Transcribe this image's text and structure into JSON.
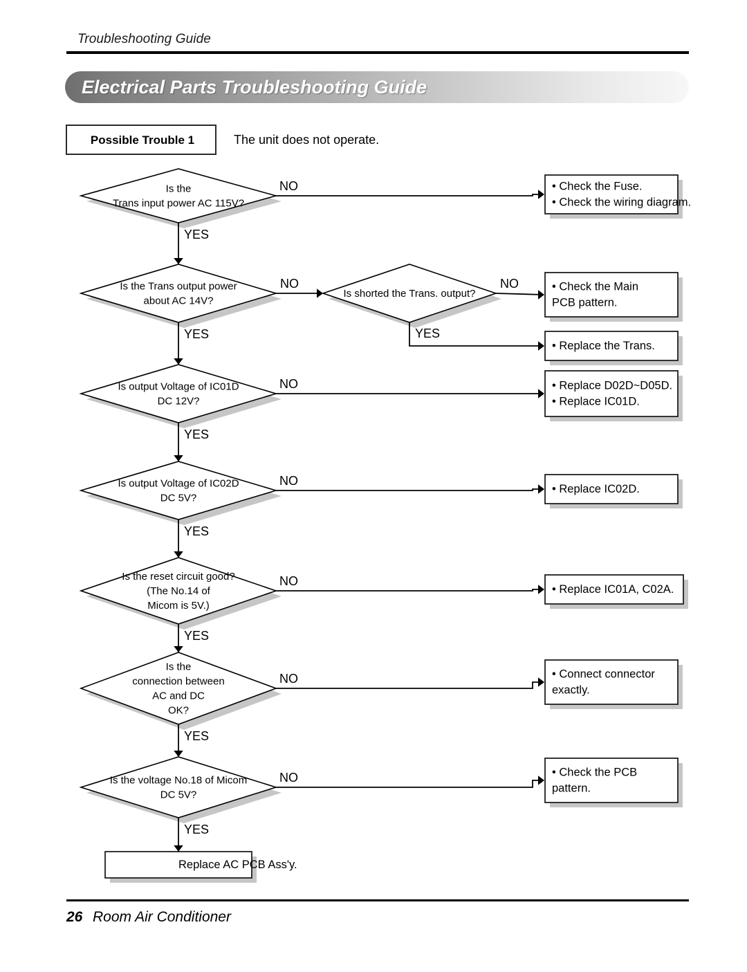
{
  "header": {
    "running_head": "Troubleshooting Guide",
    "banner_title": "Electrical Parts Troubleshooting Guide"
  },
  "trouble": {
    "label": "Possible Trouble 1",
    "description": "The unit does not operate."
  },
  "branch_labels": {
    "yes": "YES",
    "no": "NO"
  },
  "chart_data": {
    "type": "diagram",
    "title": "Electrical Parts Troubleshooting Guide",
    "subtitle": "Possible Trouble 1 — The unit does not operate.",
    "nodes": [
      {
        "id": "d1",
        "shape": "decision",
        "lines": [
          "Is the",
          "Trans input power AC 115V?"
        ],
        "yes": "d2",
        "no": "a1"
      },
      {
        "id": "d2",
        "shape": "decision",
        "lines": [
          "Is the Trans output power",
          "about AC 14V?"
        ],
        "yes": "d3",
        "no": "d2b"
      },
      {
        "id": "d2b",
        "shape": "decision",
        "lines": [
          "Is shorted the Trans. output?"
        ],
        "yes": "a3",
        "no": "a2"
      },
      {
        "id": "d3",
        "shape": "decision",
        "lines": [
          "Is output Voltage of IC01D",
          "DC 12V?"
        ],
        "yes": "d4",
        "no": "a4"
      },
      {
        "id": "d4",
        "shape": "decision",
        "lines": [
          "Is output Voltage of IC02D",
          "DC 5V?"
        ],
        "yes": "d5",
        "no": "a5"
      },
      {
        "id": "d5",
        "shape": "decision",
        "lines": [
          "Is the reset circuit good?",
          "(The No.14 of",
          "Micom is 5V.)"
        ],
        "yes": "d6",
        "no": "a6"
      },
      {
        "id": "d6",
        "shape": "decision",
        "lines": [
          "Is the",
          "connection between",
          "AC and DC",
          "OK?"
        ],
        "yes": "d7",
        "no": "a7"
      },
      {
        "id": "d7",
        "shape": "decision",
        "lines": [
          "Is the voltage No.18 of Micom",
          "DC 5V?"
        ],
        "yes": "a9",
        "no": "a8"
      },
      {
        "id": "a1",
        "shape": "action",
        "bulleted": true,
        "lines": [
          "Check the Fuse.",
          "Check the wiring diagram."
        ]
      },
      {
        "id": "a2",
        "shape": "action",
        "bulleted": true,
        "lines": [
          "Check the Main",
          "PCB pattern."
        ],
        "bullet_first_only": true
      },
      {
        "id": "a3",
        "shape": "action",
        "bulleted": true,
        "lines": [
          "Replace the Trans."
        ]
      },
      {
        "id": "a4",
        "shape": "action",
        "bulleted": true,
        "lines": [
          "Replace D02D~D05D.",
          "Replace IC01D."
        ]
      },
      {
        "id": "a5",
        "shape": "action",
        "bulleted": true,
        "lines": [
          "Replace IC02D."
        ]
      },
      {
        "id": "a6",
        "shape": "action",
        "bulleted": true,
        "lines": [
          "Replace IC01A, C02A."
        ]
      },
      {
        "id": "a7",
        "shape": "action",
        "bulleted": true,
        "lines": [
          "Connect connector",
          "exactly."
        ],
        "bullet_first_only": true
      },
      {
        "id": "a8",
        "shape": "action",
        "bulleted": true,
        "lines": [
          "Check the PCB",
          "pattern."
        ],
        "bullet_first_only": true
      },
      {
        "id": "a9",
        "shape": "terminal",
        "bulleted": false,
        "lines": [
          "Replace AC PCB Ass'y."
        ]
      }
    ]
  },
  "footer": {
    "page_number": "26",
    "book_title": "Room Air Conditioner"
  }
}
